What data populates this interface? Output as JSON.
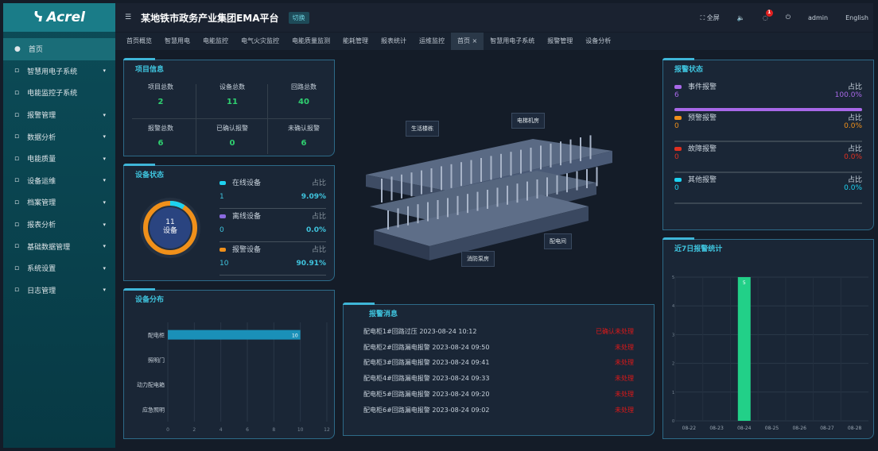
{
  "sidebar": {
    "logo": "Acrel",
    "items": [
      {
        "label": "首页",
        "icon": "home-icon"
      },
      {
        "label": "智慧用电子系统",
        "icon": "power-icon"
      },
      {
        "label": "电能监控子系统",
        "icon": "monitor-icon"
      },
      {
        "label": "报警管理",
        "icon": "alarm-icon"
      },
      {
        "label": "数据分析",
        "icon": "chart-icon"
      },
      {
        "label": "电能质量",
        "icon": "quality-icon"
      },
      {
        "label": "设备运维",
        "icon": "maintenance-icon"
      },
      {
        "label": "档案管理",
        "icon": "archive-icon"
      },
      {
        "label": "报表分析",
        "icon": "report-icon"
      },
      {
        "label": "基础数据管理",
        "icon": "database-icon"
      },
      {
        "label": "系统设置",
        "icon": "settings-icon"
      },
      {
        "label": "日志管理",
        "icon": "log-icon"
      }
    ]
  },
  "header": {
    "title": "某地铁市政务产业集团EMA平台",
    "badge": "切换",
    "fullscreen": "全屏",
    "user": "admin",
    "language": "English",
    "notification_count": "1"
  },
  "tabs": [
    "首页概览",
    "智慧用电",
    "电能监控",
    "电气火灾监控",
    "电能质量监测",
    "能耗管理",
    "报表统计",
    "运维监控",
    "首页",
    "智慧用电子系统",
    "报警管理",
    "设备分析"
  ],
  "active_tab": "首页",
  "stats": {
    "title": "项目信息",
    "items": [
      {
        "label": "项目总数",
        "value": "2"
      },
      {
        "label": "设备总数",
        "value": "11"
      },
      {
        "label": "回路总数",
        "value": "40"
      },
      {
        "label": "报警总数",
        "value": "6"
      },
      {
        "label": "已确认报警",
        "value": "0"
      },
      {
        "label": "未确认报警",
        "value": "6"
      }
    ]
  },
  "device_status": {
    "title": "设备状态",
    "center_value": "11",
    "center_label": "设备",
    "items": [
      {
        "label": "在线设备",
        "unit": "占比",
        "count": "1",
        "percent": "9.09%",
        "color": "#1ed2f0"
      },
      {
        "label": "离线设备",
        "unit": "占比",
        "count": "0",
        "percent": "0.0%",
        "color": "#8a6ae0"
      },
      {
        "label": "报警设备",
        "unit": "占比",
        "count": "10",
        "percent": "90.91%",
        "color": "#f0901a"
      }
    ]
  },
  "device_distribution": {
    "title": "设备分布",
    "categories": [
      "配电柜",
      "照明门",
      "动力配电箱",
      "应急照明"
    ],
    "values": [
      10,
      0,
      0,
      0
    ],
    "ticks": [
      "0",
      "2",
      "4",
      "6",
      "8",
      "10",
      "12"
    ],
    "bar_label": "10"
  },
  "model": {
    "callouts": [
      "生活楼栋",
      "电梯机房",
      "配电间",
      "消防泵房"
    ]
  },
  "alarm_messages": {
    "title": "报警消息",
    "items": [
      {
        "text": "配电柜1#回路过压 2023-08-24 10:12",
        "status": "已确认未处理"
      },
      {
        "text": "配电柜2#回路漏电报警 2023-08-24 09:50",
        "status": "未处理"
      },
      {
        "text": "配电柜3#回路漏电报警 2023-08-24 09:41",
        "status": "未处理"
      },
      {
        "text": "配电柜4#回路漏电报警 2023-08-24 09:33",
        "status": "未处理"
      },
      {
        "text": "配电柜5#回路漏电报警 2023-08-24 09:20",
        "status": "未处理"
      },
      {
        "text": "配电柜6#回路漏电报警 2023-08-24 09:02",
        "status": "未处理"
      }
    ]
  },
  "alarm_status": {
    "title": "报警状态",
    "items": [
      {
        "label": "事件报警",
        "unit": "占比",
        "count": "6",
        "percent": "100.0%",
        "fraction": 1.0,
        "color": "#a868e8"
      },
      {
        "label": "预警报警",
        "unit": "占比",
        "count": "0",
        "percent": "0.0%",
        "fraction": 0,
        "color": "#f0901a"
      },
      {
        "label": "故障报警",
        "unit": "占比",
        "count": "0",
        "percent": "0.0%",
        "fraction": 0,
        "color": "#e03020"
      },
      {
        "label": "其他报警",
        "unit": "占比",
        "count": "0",
        "percent": "0.0%",
        "fraction": 0,
        "color": "#1ed2f0"
      }
    ]
  },
  "chart_data": {
    "type": "bar",
    "title": "近7日报警统计",
    "categories": [
      "08-22",
      "08-23",
      "08-24",
      "08-25",
      "08-26",
      "08-27",
      "08-28"
    ],
    "values": [
      0,
      0,
      5,
      0,
      0,
      0,
      0
    ],
    "ylim": [
      0,
      5
    ],
    "yticks": [
      "0",
      "1",
      "2",
      "3",
      "4",
      "5"
    ],
    "color": "#22d088"
  }
}
